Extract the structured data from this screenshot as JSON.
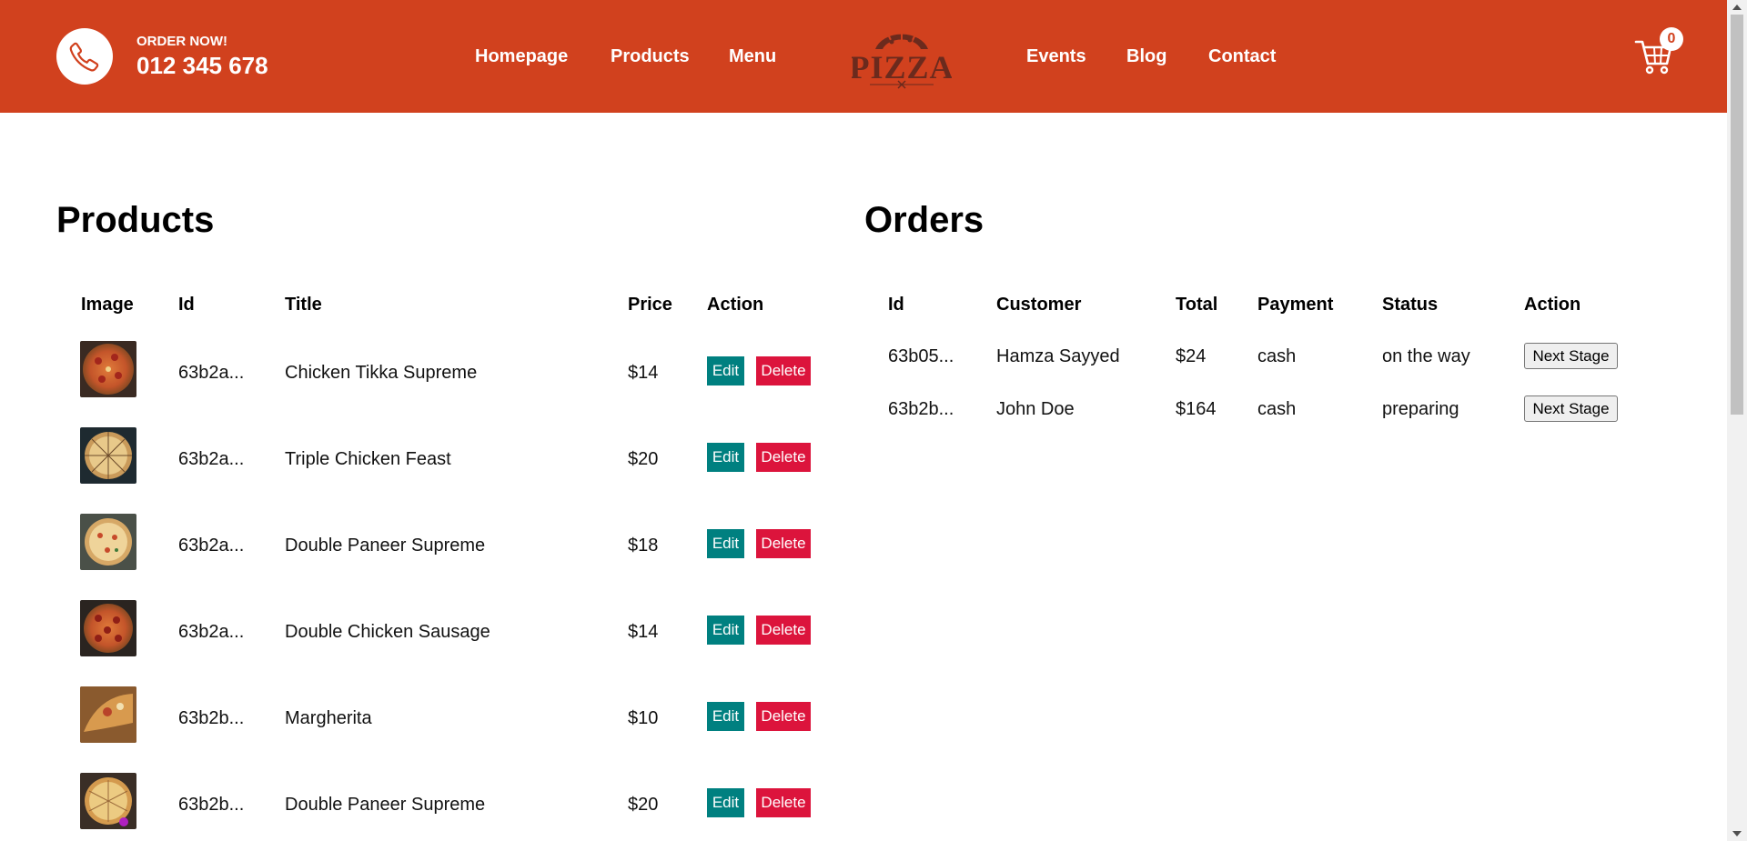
{
  "header": {
    "order_label": "ORDER NOW!",
    "phone_number": "012 345 678",
    "nav_left": [
      "Homepage",
      "Products",
      "Menu"
    ],
    "nav_right": [
      "Events",
      "Blog",
      "Contact"
    ],
    "logo_text": "PIZZA",
    "cart_count": "0",
    "brand_color": "#d1411e"
  },
  "products": {
    "title": "Products",
    "columns": [
      "Image",
      "Id",
      "Title",
      "Price",
      "Action"
    ],
    "edit_label": "Edit",
    "delete_label": "Delete",
    "rows": [
      {
        "id": "63b2a...",
        "title": "Chicken Tikka Supreme",
        "price": "$14"
      },
      {
        "id": "63b2a...",
        "title": "Triple Chicken Feast",
        "price": "$20"
      },
      {
        "id": "63b2a...",
        "title": "Double Paneer Supreme",
        "price": "$18"
      },
      {
        "id": "63b2a...",
        "title": "Double Chicken Sausage",
        "price": "$14"
      },
      {
        "id": "63b2b...",
        "title": "Margherita",
        "price": "$10"
      },
      {
        "id": "63b2b...",
        "title": "Double Paneer Supreme",
        "price": "$20"
      }
    ]
  },
  "orders": {
    "title": "Orders",
    "columns": [
      "Id",
      "Customer",
      "Total",
      "Payment",
      "Status",
      "Action"
    ],
    "next_label": "Next Stage",
    "rows": [
      {
        "id": "63b05...",
        "customer": "Hamza Sayyed",
        "total": "$24",
        "payment": "cash",
        "status": "on the way"
      },
      {
        "id": "63b2b...",
        "customer": "John Doe",
        "total": "$164",
        "payment": "cash",
        "status": "preparing"
      }
    ]
  },
  "colors": {
    "edit": "#008080",
    "delete": "#dc143c"
  },
  "icons": [
    "phone-icon",
    "pizza-logo",
    "cart-icon",
    "pizza-thumbnail"
  ]
}
